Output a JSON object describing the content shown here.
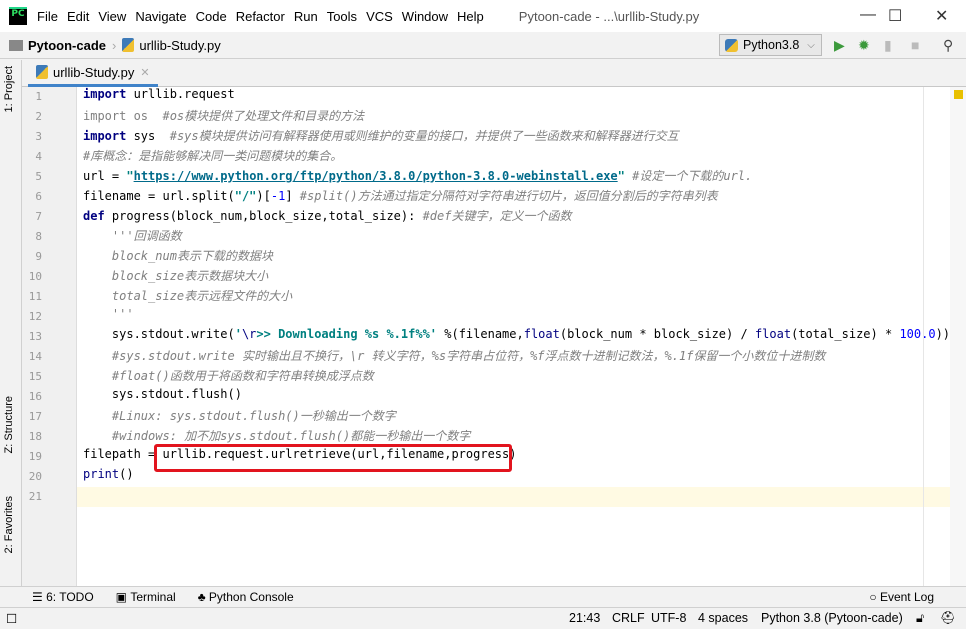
{
  "window": {
    "title": "Pytoon-cade - ...\\urllib-Study.py",
    "logo": "PC",
    "controls": [
      "—",
      "☐",
      "✕"
    ]
  },
  "menu": [
    "File",
    "Edit",
    "View",
    "Navigate",
    "Code",
    "Refactor",
    "Run",
    "Tools",
    "VCS",
    "Window",
    "Help"
  ],
  "breadcrumb": {
    "project": "Pytoon-cade",
    "file": "urllib-Study.py"
  },
  "run_config": {
    "label": "Python3.8"
  },
  "tab": {
    "label": "urllib-Study.py"
  },
  "sidebar": {
    "project": "1: Project",
    "structure": "Z: Structure",
    "favorites": "2: Favorites"
  },
  "editor": {
    "lines": [
      [
        [
          "import",
          "k"
        ],
        [
          " urllib.request",
          ""
        ]
      ],
      [
        [
          "import os",
          "g"
        ],
        [
          "  #os模块提供了处理文件和目录的方法",
          "c"
        ]
      ],
      [
        [
          "import",
          "k"
        ],
        [
          " sys  ",
          ""
        ],
        [
          "#sys模块提供访问有解释器使用或则维护的变量的接口，并提供了一些函数来和解释器进行交互",
          "c"
        ]
      ],
      [
        [
          "#库概念：是指能够解决同一类问题模块的集合。",
          "c"
        ]
      ],
      [
        [
          "url = ",
          ""
        ],
        [
          "\"",
          "s"
        ],
        [
          "https://www.python.org/ftp/python/3.8.0/python-3.8.0-webinstall.exe",
          "u"
        ],
        [
          "\"",
          "s"
        ],
        [
          " #设定一个下载的url.",
          "c"
        ]
      ],
      [
        [
          "filename = url.split(",
          ""
        ],
        [
          "\"/\"",
          "s"
        ],
        [
          ")[",
          ""
        ],
        [
          "-1",
          "n"
        ],
        [
          "] ",
          ""
        ],
        [
          "#split()方法通过指定分隔符对字符串进行切片，返回值分割后的字符串列表",
          "c"
        ]
      ],
      [
        [
          "def",
          "k"
        ],
        [
          " progress(block_num,block_size,total_size): ",
          ""
        ],
        [
          "#def关键字，定义一个函数",
          "c"
        ]
      ],
      [
        [
          "    '''回调函数",
          "doc"
        ]
      ],
      [
        [
          "    block_num表示下载的数据块",
          "doc"
        ]
      ],
      [
        [
          "    block_size表示数据块大小",
          "doc"
        ]
      ],
      [
        [
          "    total_size表示远程文件的大小",
          "doc"
        ]
      ],
      [
        [
          "    '''",
          "doc"
        ]
      ],
      [
        [
          "    sys.stdout.write(",
          ""
        ],
        [
          "'",
          "s"
        ],
        [
          "\\r",
          "b"
        ],
        [
          ">> Downloading %s %.1f%%'",
          "s"
        ],
        [
          " %(filename,",
          ""
        ],
        [
          "float",
          "b"
        ],
        [
          "(block_num * block_size) / ",
          ""
        ],
        [
          "float",
          "b"
        ],
        [
          "(total_size) * ",
          ""
        ],
        [
          "100.0",
          "n"
        ],
        [
          "))",
          ""
        ]
      ],
      [
        [
          "    ",
          ""
        ],
        [
          "#sys.stdout.write 实时输出且不换行，\\r 转义字符，%s字符串占位符，%f浮点数十进制记数法，%.1f保留一个小数位十进制数",
          "c"
        ]
      ],
      [
        [
          "    ",
          ""
        ],
        [
          "#float()函数用于将函数和字符串转换成浮点数",
          "c"
        ]
      ],
      [
        [
          "    sys.stdout.flush()",
          ""
        ]
      ],
      [
        [
          "    ",
          ""
        ],
        [
          "#Linux: sys.stdout.flush()一秒输出一个数字",
          "c"
        ]
      ],
      [
        [
          "    ",
          ""
        ],
        [
          "#windows: 加不加sys.stdout.flush()都能一秒输出一个数字",
          "c"
        ]
      ],
      [
        [
          "filepath = urllib.request.urlretrieve(url,filename,progress)",
          ""
        ]
      ],
      [
        [
          "print",
          "b"
        ],
        [
          "()",
          ""
        ]
      ],
      [
        [
          "",
          ""
        ]
      ]
    ]
  },
  "bottom_tools": {
    "todo": "6: TODO",
    "terminal": "Terminal",
    "console": "Python Console",
    "event_log": "Event Log"
  },
  "status": {
    "position": "21:43",
    "line_sep": "CRLF",
    "encoding": "UTF-8",
    "indent": "4 spaces",
    "interpreter": "Python 3.8 (Pytoon-cade)"
  }
}
